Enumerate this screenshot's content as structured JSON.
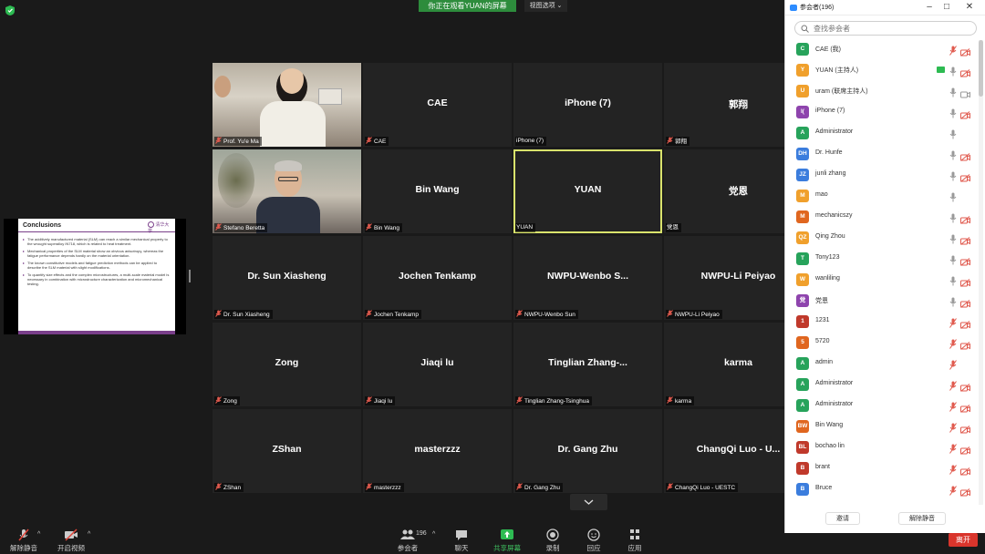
{
  "banner": {
    "text": "你正在观看YUAN的屏幕",
    "view_options": "视图选项"
  },
  "slide": {
    "title": "Conclusions",
    "logo_text": "清华大学",
    "bullets": [
      "The additively manufactured material (SLM) can reach a similar mechanical property to the wrought superalloy IN718, which is related to heat treatment.",
      "Mechanical properties of the SLM material show an obvious anisotropy, whereas the fatigue performance depends hardly on the material orientation.",
      "The known constitutive models and fatigue prediction methods can be applied to describe the SLM material with slight modifications.",
      "To quantify size effects and the complex microstructures, a multi-scale material model is necessary in combination with microstructure characterization and micromechanical testing."
    ]
  },
  "tiles": [
    {
      "name": "",
      "label": "Prof. Yu'e Ma",
      "video": "photo1",
      "muted": true
    },
    {
      "name": "CAE",
      "label": "CAE",
      "muted": true
    },
    {
      "name": "iPhone (7)",
      "label": "iPhone (7)",
      "muted": false
    },
    {
      "name": "郭翔",
      "label": "郭翔",
      "muted": true
    },
    {
      "name": "",
      "label": "Stefano Beretta",
      "video": "photo2",
      "muted": true
    },
    {
      "name": "Bin Wang",
      "label": "Bin Wang",
      "muted": true
    },
    {
      "name": "YUAN",
      "label": "YUAN",
      "muted": false,
      "active": true
    },
    {
      "name": "党恩",
      "label": "党恩",
      "muted": false
    },
    {
      "name": "Dr. Sun Xiasheng",
      "label": "Dr. Sun Xiasheng",
      "muted": true
    },
    {
      "name": "Jochen Tenkamp",
      "label": "Jochen Tenkamp",
      "muted": true
    },
    {
      "name": "NWPU-Wenbo  S...",
      "label": "NWPU-Wenbo Sun",
      "muted": true
    },
    {
      "name": "NWPU-Li Peiyao",
      "label": "NWPU-Li Peiyao",
      "muted": true
    },
    {
      "name": "Zong",
      "label": "Zong",
      "muted": true
    },
    {
      "name": "Jiaqi lu",
      "label": "Jiaqi lu",
      "muted": true
    },
    {
      "name": "Tinglian  Zhang-...",
      "label": "Tinglian Zhang-Tsinghua",
      "muted": true
    },
    {
      "name": "karma",
      "label": "karma",
      "muted": true
    },
    {
      "name": "ZShan",
      "label": "ZShan",
      "muted": true
    },
    {
      "name": "masterzzz",
      "label": "masterzzz",
      "muted": true
    },
    {
      "name": "Dr. Gang Zhu",
      "label": "Dr. Gang Zhu",
      "muted": true
    },
    {
      "name": "ChangQi Luo - U...",
      "label": "ChangQi Luo - UESTC",
      "muted": true
    }
  ],
  "toolbar": {
    "unmute": "解除静音",
    "start_video": "开启视频",
    "participants": "参会者",
    "participants_count": "196",
    "chat": "聊天",
    "share": "共享屏幕",
    "record": "录制",
    "reactions": "回应",
    "apps": "应用",
    "leave": "离开"
  },
  "panel": {
    "title": "参会者(196)",
    "search_placeholder": "查找参会者",
    "invite": "邀请",
    "unmute_me": "解除静音",
    "participants": [
      {
        "initials": "C",
        "color": "#27a35b",
        "name": "CAE (我)",
        "mic": "muted",
        "cam": "off"
      },
      {
        "initials": "Y",
        "color": "#f0a02c",
        "name": "YUAN (主持人)",
        "mic": "on",
        "cam": "off",
        "sharing": true
      },
      {
        "initials": "U",
        "color": "#f0a02c",
        "name": "uram (联席主持人)",
        "mic": "on",
        "cam": "on"
      },
      {
        "initials": "I(",
        "color": "#8e44ad",
        "name": "iPhone (7)",
        "mic": "on",
        "cam": "off"
      },
      {
        "initials": "A",
        "color": "#27a35b",
        "name": "Administrator",
        "mic": "on",
        "cam": "none"
      },
      {
        "initials": "DH",
        "color": "#3b7ddd",
        "name": "Dr. Hunfe",
        "mic": "on",
        "cam": "off"
      },
      {
        "initials": "JZ",
        "color": "#3b7ddd",
        "name": "junli zhang",
        "mic": "on",
        "cam": "off"
      },
      {
        "initials": "M",
        "color": "#f0a02c",
        "name": "mao",
        "mic": "on",
        "cam": "none"
      },
      {
        "initials": "M",
        "color": "#e0661f",
        "name": "mechanicszy",
        "mic": "on",
        "cam": "off"
      },
      {
        "initials": "QZ",
        "color": "#f0a02c",
        "name": "Qing Zhou",
        "mic": "on",
        "cam": "off"
      },
      {
        "initials": "T",
        "color": "#27a35b",
        "name": "Tony123",
        "mic": "on",
        "cam": "off"
      },
      {
        "initials": "W",
        "color": "#f0a02c",
        "name": "wanliling",
        "mic": "on",
        "cam": "off"
      },
      {
        "initials": "党",
        "color": "#8e44ad",
        "name": "党恩",
        "mic": "on",
        "cam": "off"
      },
      {
        "initials": "1",
        "color": "#c0392b",
        "name": "1231",
        "mic": "muted",
        "cam": "off"
      },
      {
        "initials": "5",
        "color": "#e0661f",
        "name": "5720",
        "mic": "muted",
        "cam": "off"
      },
      {
        "initials": "A",
        "color": "#27a35b",
        "name": "admin",
        "mic": "muted",
        "cam": "none"
      },
      {
        "initials": "A",
        "color": "#27a35b",
        "name": "Administrator",
        "mic": "muted",
        "cam": "off"
      },
      {
        "initials": "A",
        "color": "#27a35b",
        "name": "Administrator",
        "mic": "muted",
        "cam": "off"
      },
      {
        "initials": "BW",
        "color": "#e0661f",
        "name": "Bin Wang",
        "mic": "muted",
        "cam": "off"
      },
      {
        "initials": "BL",
        "color": "#c0392b",
        "name": "bochao lin",
        "mic": "muted",
        "cam": "off"
      },
      {
        "initials": "B",
        "color": "#c0392b",
        "name": "brant",
        "mic": "muted",
        "cam": "off"
      },
      {
        "initials": "B",
        "color": "#3b7ddd",
        "name": "Bruce",
        "mic": "muted",
        "cam": "off"
      }
    ]
  }
}
